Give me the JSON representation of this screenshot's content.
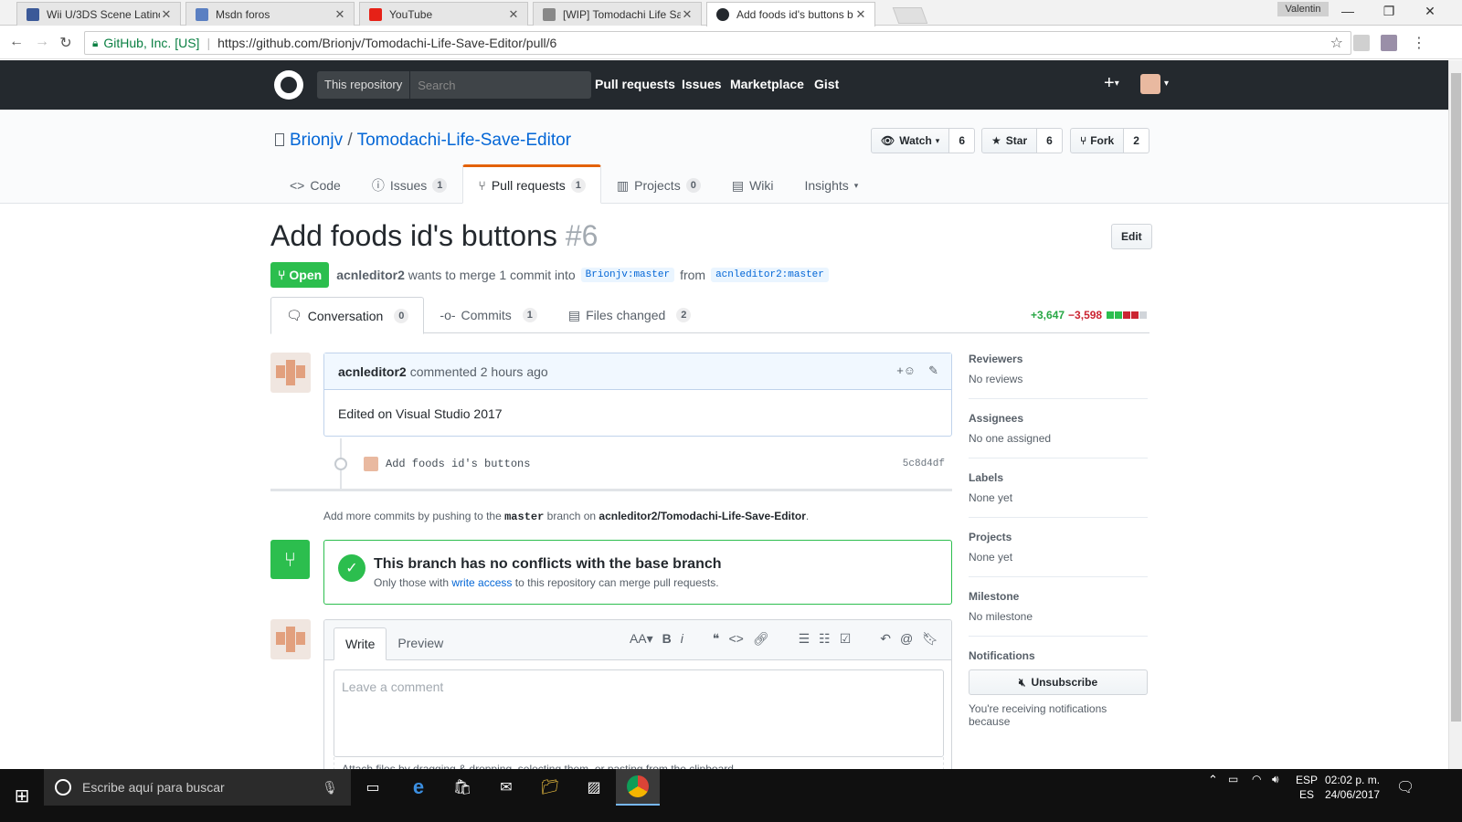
{
  "browser": {
    "tabs": [
      {
        "label": "Wii U/3DS Scene Latinoa",
        "fav_color": "#3b5998"
      },
      {
        "label": "Msdn foros",
        "fav_color": "#5a7fc2"
      },
      {
        "label": "YouTube",
        "fav_color": "#e62117"
      },
      {
        "label": "[WIP] Tomodachi Life Sa",
        "fav_color": "#888888"
      },
      {
        "label": "Add foods id's buttons b",
        "fav_color": "#24292e"
      }
    ],
    "profile_name": "Valentin",
    "site_identity": "GitHub, Inc. [US]",
    "url": "https://github.com/Brionjv/Tomodachi-Life-Save-Editor/pull/6"
  },
  "gh_header": {
    "scope": "This repository",
    "search_placeholder": "Search",
    "nav": [
      "Pull requests",
      "Issues",
      "Marketplace",
      "Gist"
    ],
    "plus": "+"
  },
  "repo": {
    "owner": "Brionjv",
    "name": "Tomodachi-Life-Save-Editor",
    "watch_label": "Watch",
    "watch_count": "6",
    "star_label": "Star",
    "star_count": "6",
    "fork_label": "Fork",
    "fork_count": "2",
    "nav": {
      "code": "Code",
      "issues": "Issues",
      "issues_count": "1",
      "pulls": "Pull requests",
      "pulls_count": "1",
      "projects": "Projects",
      "projects_count": "0",
      "wiki": "Wiki",
      "insights": "Insights"
    }
  },
  "pr": {
    "title": "Add foods id's buttons",
    "number": "#6",
    "edit_label": "Edit",
    "state": "Open",
    "author": "acnleditor2",
    "merge_text": "wants to merge 1 commit into",
    "base_branch": "Brionjv:master",
    "from_text": "from",
    "head_branch": "acnleditor2:master",
    "tabs": {
      "conversation": "Conversation",
      "conversation_count": "0",
      "commits": "Commits",
      "commits_count": "1",
      "files": "Files changed",
      "files_count": "2"
    },
    "additions": "+3,647",
    "deletions": "−3,598",
    "diff_blocks": [
      1,
      1,
      0,
      0,
      2
    ]
  },
  "timeline": {
    "comment_author": "acnleditor2",
    "comment_meta": "commented 2 hours ago",
    "comment_body": "Edited on Visual Studio 2017",
    "commit_message": "Add foods id's buttons",
    "commit_sha": "5c8d4df",
    "push_hint_1": "Add more commits by pushing to the",
    "push_hint_branch": "master",
    "push_hint_2": "branch on",
    "push_hint_repo": "acnleditor2/Tomodachi-Life-Save-Editor",
    "merge_title": "This branch has no conflicts with the base branch",
    "merge_sub_1": "Only those with",
    "merge_sub_link": "write access",
    "merge_sub_2": "to this repository can merge pull requests."
  },
  "new_comment": {
    "write_tab": "Write",
    "preview_tab": "Preview",
    "placeholder": "Leave a comment",
    "footer": "Attach files by dragging & dropping, selecting them, or pasting from the clipboard."
  },
  "sidebar": {
    "reviewers_title": "Reviewers",
    "reviewers_value": "No reviews",
    "assignees_title": "Assignees",
    "assignees_value": "No one assigned",
    "labels_title": "Labels",
    "labels_value": "None yet",
    "projects_title": "Projects",
    "projects_value": "None yet",
    "milestone_title": "Milestone",
    "milestone_value": "No milestone",
    "notifications_title": "Notifications",
    "unsubscribe_label": "Unsubscribe",
    "notifications_note": "You're receiving notifications because"
  },
  "taskbar": {
    "search_placeholder": "Escribe aquí para buscar",
    "lang_1": "ESP",
    "lang_2": "ES",
    "time": "02:02 p. m.",
    "date": "24/06/2017"
  }
}
